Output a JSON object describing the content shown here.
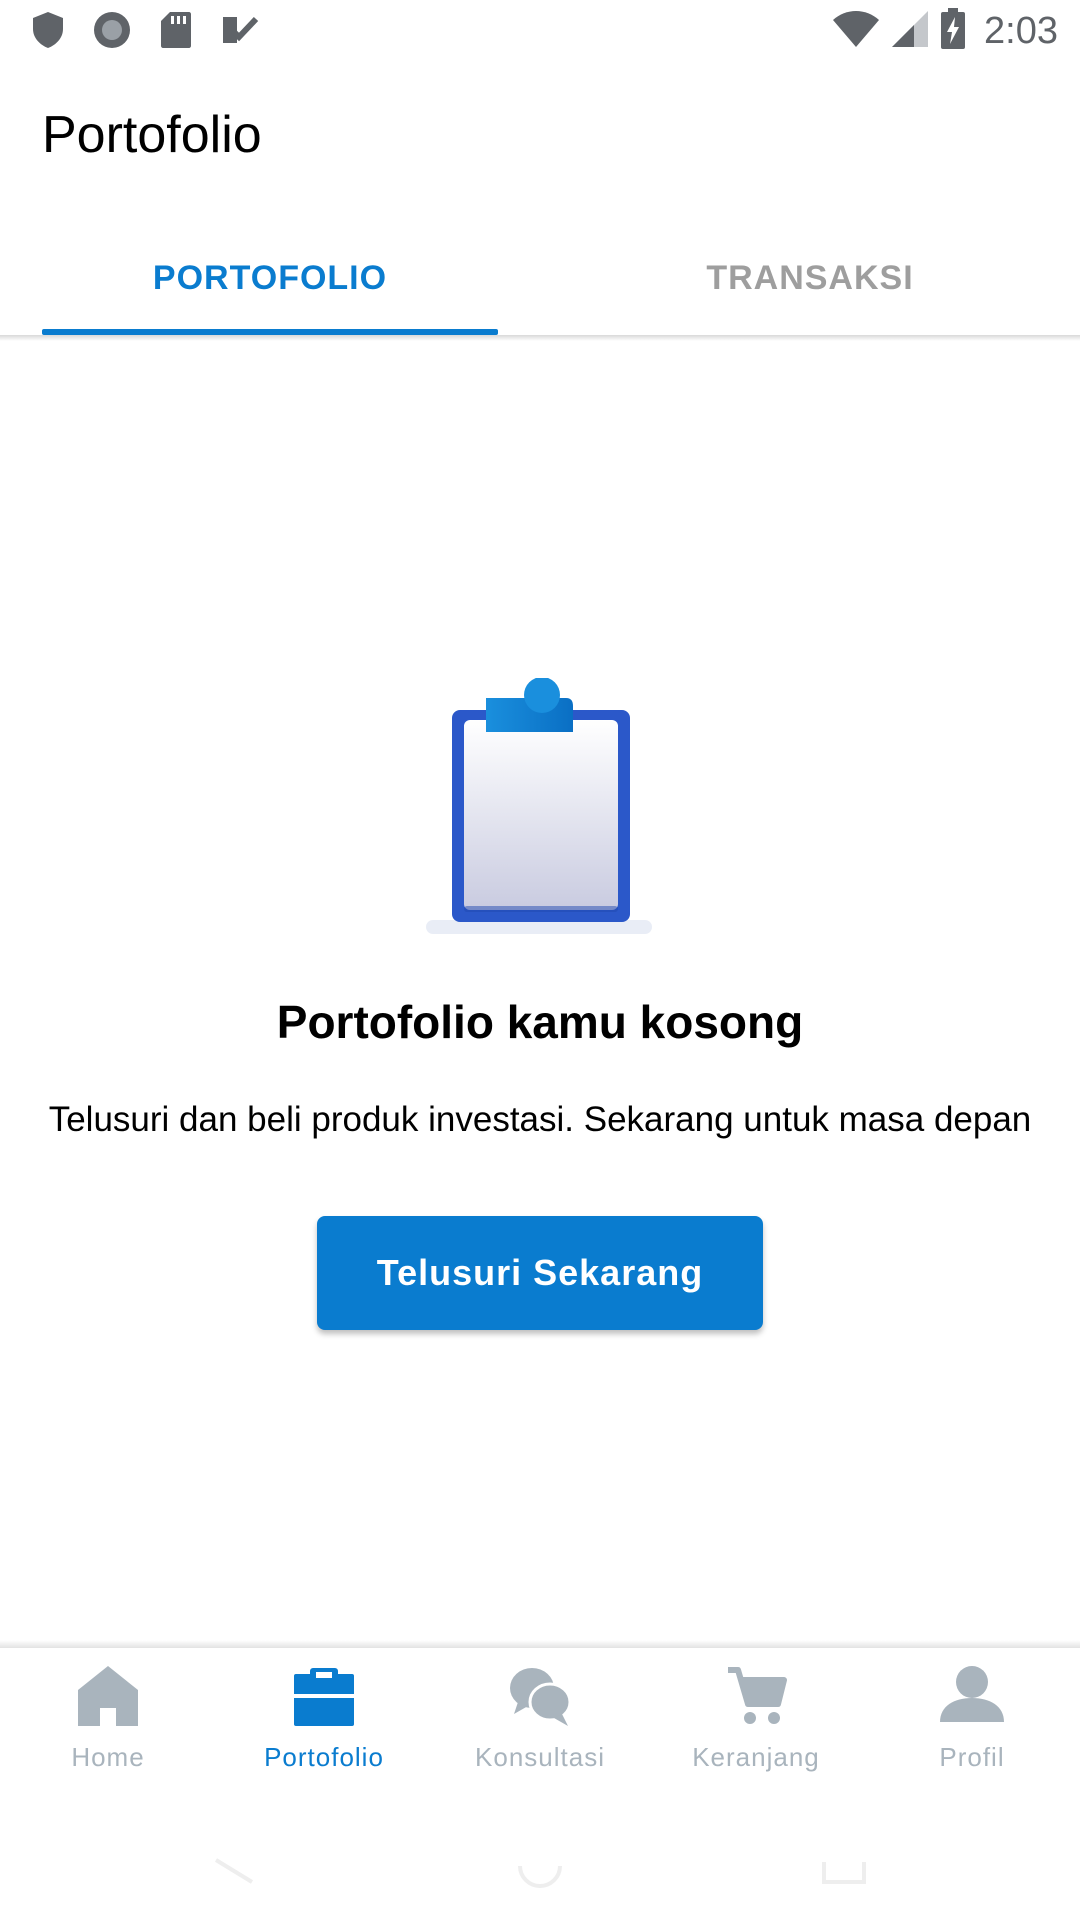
{
  "status_bar": {
    "time": "2:03",
    "icons_left": [
      "shield-icon",
      "record-icon",
      "sd-card-icon",
      "check-task-icon"
    ],
    "icons_right": [
      "wifi-icon",
      "signal-icon",
      "battery-charging-icon"
    ]
  },
  "app_bar": {
    "title": "Portofolio"
  },
  "tabs": [
    {
      "label": "PORTOFOLIO",
      "active": true
    },
    {
      "label": "TRANSAKSI",
      "active": false
    }
  ],
  "empty_state": {
    "illustration": "clipboard-icon",
    "title": "Portofolio kamu kosong",
    "description": "Telusuri dan beli produk investasi. Sekarang untuk masa depan",
    "button_label": "Telusuri Sekarang"
  },
  "bottom_nav": {
    "items": [
      {
        "label": "Home",
        "icon": "home-icon",
        "active": false
      },
      {
        "label": "Portofolio",
        "icon": "portfolio-icon",
        "active": true
      },
      {
        "label": "Konsultasi",
        "icon": "chat-icon",
        "active": false
      },
      {
        "label": "Keranjang",
        "icon": "cart-icon",
        "active": false
      },
      {
        "label": "Profil",
        "icon": "profile-icon",
        "active": false
      }
    ]
  },
  "colors": {
    "accent": "#0a7ccf",
    "inactive": "#a9b4bd",
    "tab_inactive": "#9e9e9e"
  }
}
